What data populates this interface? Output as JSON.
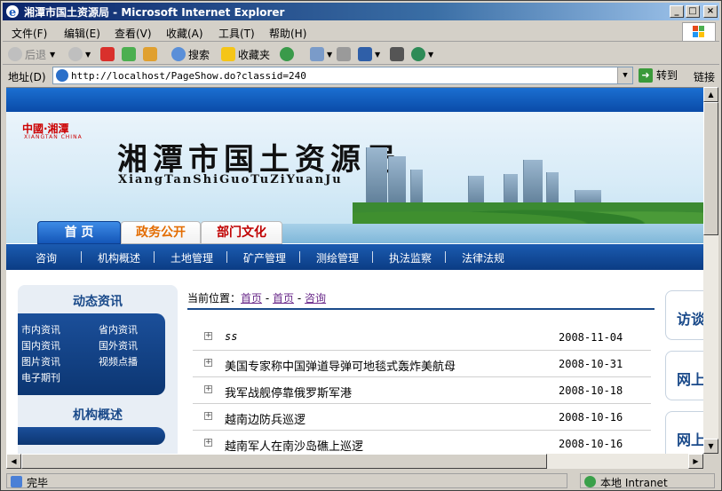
{
  "window": {
    "title": "湘潭市国土资源局 - Microsoft Internet Explorer",
    "min_label": "_",
    "max_label": "□",
    "close_label": "×"
  },
  "menu": [
    "文件(F)",
    "编辑(E)",
    "查看(V)",
    "收藏(A)",
    "工具(T)",
    "帮助(H)"
  ],
  "toolbar": {
    "back": "后退",
    "search": "搜索",
    "favorites": "收藏夹"
  },
  "address": {
    "label": "地址(D)",
    "url": "http://localhost/PageShow.do?classid=240",
    "go": "转到",
    "links": "链接"
  },
  "site": {
    "logo_cn": "中國·湘潭",
    "logo_en": "XIANGTAN CHINA",
    "title": "湘潭市国土资源局",
    "pinyin": "XiangTanShiGuoTuZiYuanJu",
    "tabs": [
      "首 页",
      "政务公开",
      "部门文化"
    ],
    "nav": [
      "咨询",
      "机构概述",
      "土地管理",
      "矿产管理",
      "测绘管理",
      "执法监察",
      "法律法规"
    ],
    "left": {
      "head1": "动态资讯",
      "links": [
        "市内资讯",
        "省内资讯",
        "国内资讯",
        "国外资讯",
        "图片资讯",
        "视频点播",
        "电子期刊"
      ],
      "head2": "机构概述"
    },
    "breadcrumb": {
      "prefix": "当前位置：",
      "items": [
        "首页",
        "首页",
        "咨询"
      ],
      "sep": "-"
    },
    "news": [
      {
        "title": "ss",
        "date": "2008-11-04"
      },
      {
        "title": "美国专家称中国弹道导弹可地毯式轰炸美航母",
        "date": "2008-10-31"
      },
      {
        "title": "我军战舰停靠俄罗斯军港",
        "date": "2008-10-18"
      },
      {
        "title": "越南边防兵巡逻",
        "date": "2008-10-16"
      },
      {
        "title": "越南军人在南沙岛礁上巡逻",
        "date": "2008-10-16"
      }
    ],
    "right": [
      "访谈",
      "网上",
      "网上"
    ]
  },
  "status": {
    "left": "完毕",
    "zone": "本地 Intranet"
  }
}
